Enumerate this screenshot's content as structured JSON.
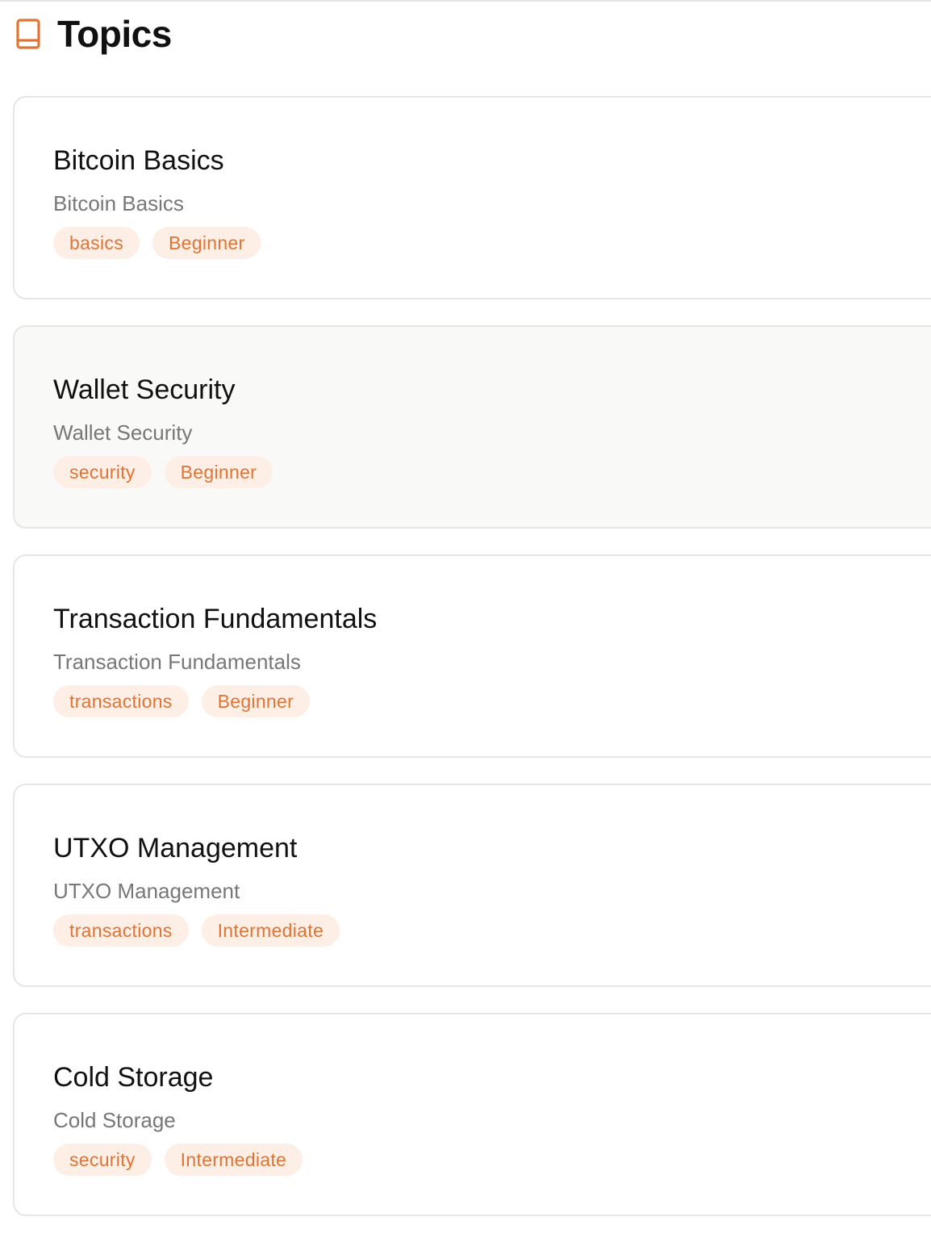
{
  "header": {
    "title": "Topics",
    "icon": "book-icon",
    "accent_color": "#e07434"
  },
  "topics": [
    {
      "title": "Bitcoin Basics",
      "description": "Bitcoin Basics",
      "tags": [
        "basics",
        "Beginner"
      ]
    },
    {
      "title": "Wallet Security",
      "description": "Wallet Security",
      "tags": [
        "security",
        "Beginner"
      ]
    },
    {
      "title": "Transaction Fundamentals",
      "description": "Transaction Fundamentals",
      "tags": [
        "transactions",
        "Beginner"
      ]
    },
    {
      "title": "UTXO Management",
      "description": "UTXO Management",
      "tags": [
        "transactions",
        "Intermediate"
      ]
    },
    {
      "title": "Cold Storage",
      "description": "Cold Storage",
      "tags": [
        "security",
        "Intermediate"
      ]
    }
  ]
}
